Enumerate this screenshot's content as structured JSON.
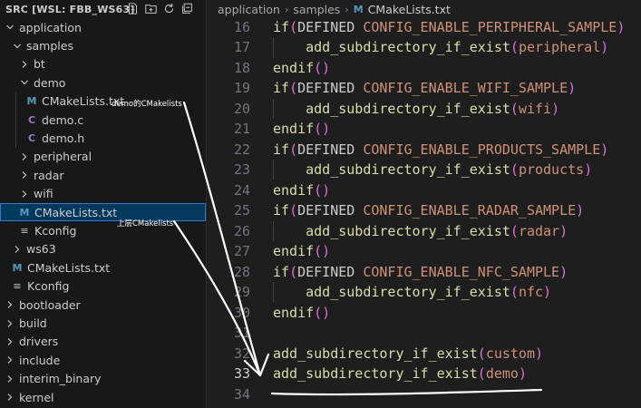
{
  "sidebar": {
    "title": "SRC [WSL: FBB_WS63]",
    "actions": [
      "new-file-icon",
      "new-folder-icon",
      "refresh-icon",
      "collapse-all-icon"
    ],
    "items": [
      {
        "label": "application",
        "depth": 0,
        "type": "folder",
        "open": true
      },
      {
        "label": "samples",
        "depth": 1,
        "type": "folder",
        "open": true
      },
      {
        "label": "bt",
        "depth": 2,
        "type": "folder",
        "open": false
      },
      {
        "label": "demo",
        "depth": 2,
        "type": "folder",
        "open": true
      },
      {
        "label": "CMakeLists.txt",
        "depth": 3,
        "type": "cmake",
        "icon": "M"
      },
      {
        "label": "demo.c",
        "depth": 3,
        "type": "c",
        "icon": "C"
      },
      {
        "label": "demo.h",
        "depth": 3,
        "type": "c",
        "icon": "C"
      },
      {
        "label": "peripheral",
        "depth": 2,
        "type": "folder",
        "open": false
      },
      {
        "label": "radar",
        "depth": 2,
        "type": "folder",
        "open": false
      },
      {
        "label": "wifi",
        "depth": 2,
        "type": "folder",
        "open": false
      },
      {
        "label": "CMakeLists.txt",
        "depth": 2,
        "type": "cmake",
        "icon": "M",
        "selected": true
      },
      {
        "label": "Kconfig",
        "depth": 2,
        "type": "kconfig",
        "icon": "≡"
      },
      {
        "label": "ws63",
        "depth": 1,
        "type": "folder",
        "open": false
      },
      {
        "label": "CMakeLists.txt",
        "depth": 1,
        "type": "cmake",
        "icon": "M"
      },
      {
        "label": "Kconfig",
        "depth": 1,
        "type": "kconfig",
        "icon": "≡"
      },
      {
        "label": "bootloader",
        "depth": 0,
        "type": "folder",
        "open": false
      },
      {
        "label": "build",
        "depth": 0,
        "type": "folder",
        "open": false
      },
      {
        "label": "drivers",
        "depth": 0,
        "type": "folder",
        "open": false
      },
      {
        "label": "include",
        "depth": 0,
        "type": "folder",
        "open": false
      },
      {
        "label": "interim_binary",
        "depth": 0,
        "type": "folder",
        "open": false
      },
      {
        "label": "kernel",
        "depth": 0,
        "type": "folder",
        "open": false
      }
    ]
  },
  "annotations": {
    "demo_note": "demo的CMakelists",
    "upper_note": "上层CMakelists"
  },
  "breadcrumb": {
    "parts": [
      "application",
      "samples"
    ],
    "file_icon": "M",
    "file": "CMakeLists.txt"
  },
  "editor": {
    "lines": [
      {
        "n": "16",
        "kind": "if",
        "macro": "CONFIG_ENABLE_PERIPHERAL_SAMPLE"
      },
      {
        "n": "17",
        "kind": "add",
        "arg": "peripheral",
        "indent": true
      },
      {
        "n": "18",
        "kind": "endif"
      },
      {
        "n": "19",
        "kind": "if",
        "macro": "CONFIG_ENABLE_WIFI_SAMPLE"
      },
      {
        "n": "20",
        "kind": "add",
        "arg": "wifi",
        "indent": true
      },
      {
        "n": "21",
        "kind": "endif"
      },
      {
        "n": "22",
        "kind": "if",
        "macro": "CONFIG_ENABLE_PRODUCTS_SAMPLE"
      },
      {
        "n": "23",
        "kind": "add",
        "arg": "products",
        "indent": true
      },
      {
        "n": "24",
        "kind": "endif"
      },
      {
        "n": "25",
        "kind": "if",
        "macro": "CONFIG_ENABLE_RADAR_SAMPLE"
      },
      {
        "n": "26",
        "kind": "add",
        "arg": "radar",
        "indent": true
      },
      {
        "n": "27",
        "kind": "endif"
      },
      {
        "n": "28",
        "kind": "if",
        "macro": "CONFIG_ENABLE_NFC_SAMPLE"
      },
      {
        "n": "29",
        "kind": "add",
        "arg": "nfc",
        "indent": true
      },
      {
        "n": "30",
        "kind": "endif"
      },
      {
        "n": "31",
        "kind": "blank"
      },
      {
        "n": "32",
        "kind": "add",
        "arg": "custom"
      },
      {
        "n": "33",
        "kind": "add",
        "arg": "demo",
        "active": true
      },
      {
        "n": "34",
        "kind": "blank"
      }
    ],
    "tokens": {
      "if": "if",
      "defined": "DEFINED ",
      "endif": "endif",
      "fn": "add_subdirectory_if_exist",
      "open": "(",
      "close": ")",
      "empty_parens": "()"
    }
  },
  "colors": {
    "keyword": "#dcdcaa",
    "paren": "#da70d6",
    "macro": "#ce9178",
    "annotation_stroke": "#ffffff"
  }
}
